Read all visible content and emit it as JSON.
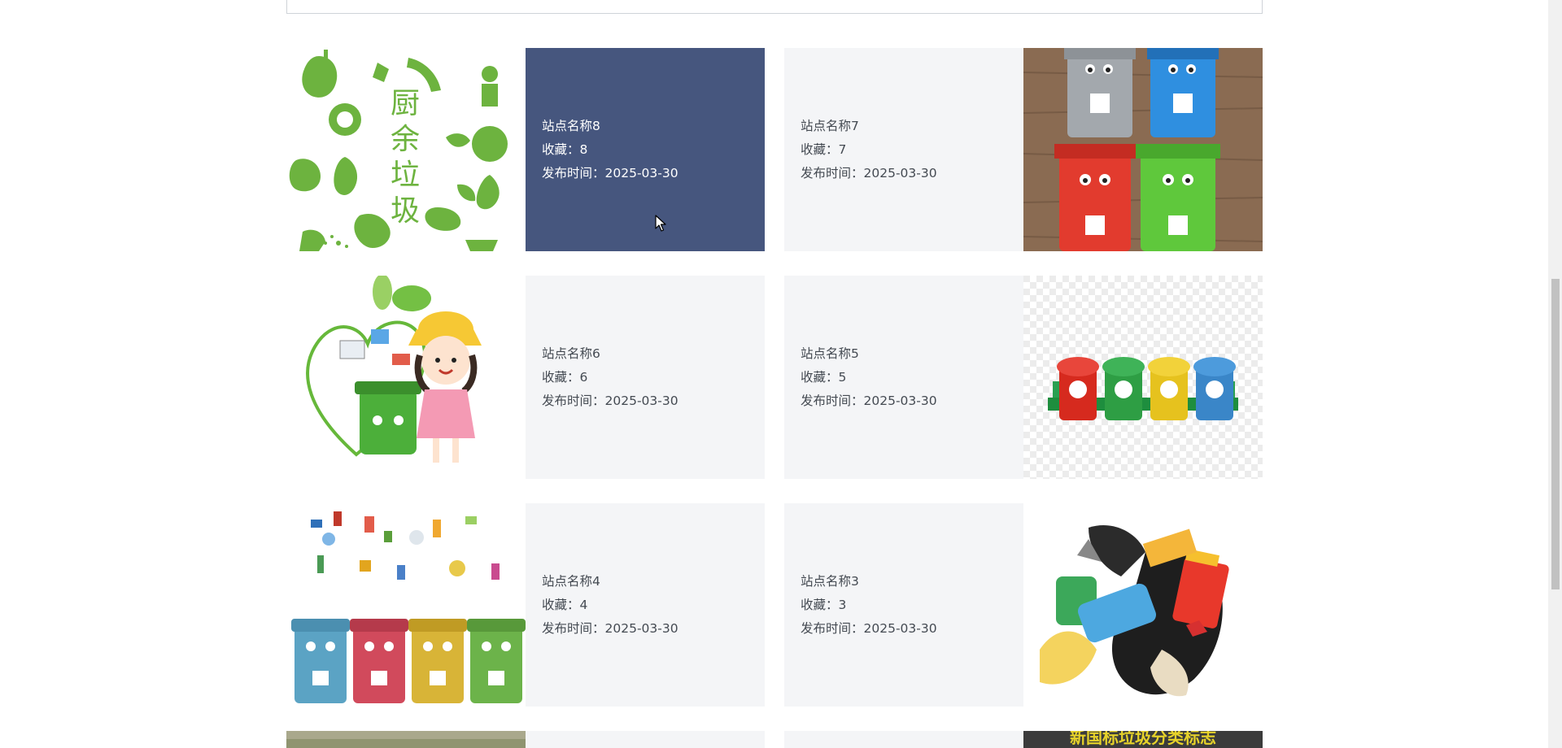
{
  "cards": [
    {
      "id": "8",
      "name": "站点名称8",
      "favorites_label": "收藏：",
      "favorites": "8",
      "date_label": "发布时间：",
      "date": "2025-03-30",
      "image": "food-waste-image",
      "image_text": [
        "厨",
        "余",
        "垃",
        "圾"
      ]
    },
    {
      "id": "7",
      "name": "站点名称7",
      "favorites_label": "收藏：",
      "favorites": "7",
      "date_label": "发布时间：",
      "date": "2025-03-30",
      "image": "sorting-bins-wood-image"
    },
    {
      "id": "6",
      "name": "站点名称6",
      "favorites_label": "收藏：",
      "favorites": "6",
      "date_label": "发布时间：",
      "date": "2025-03-30",
      "image": "girl-recycling-image"
    },
    {
      "id": "5",
      "name": "站点名称5",
      "favorites_label": "收藏：",
      "favorites": "5",
      "date_label": "发布时间：",
      "date": "2025-03-30",
      "image": "four-bins-image"
    },
    {
      "id": "4",
      "name": "站点名称4",
      "favorites_label": "收藏：",
      "favorites": "4",
      "date_label": "发布时间：",
      "date": "2025-03-30",
      "image": "bins-with-waste-image"
    },
    {
      "id": "3",
      "name": "站点名称3",
      "favorites_label": "收藏：",
      "favorites": "3",
      "date_label": "发布时间：",
      "date": "2025-03-30",
      "image": "garbage-pile-image"
    }
  ],
  "partial_bottom_banner": "新国标垃圾分类标志",
  "colors": {
    "active_card": "#46567e",
    "card_bg": "#f4f5f7",
    "food_green": "#6db33f"
  }
}
